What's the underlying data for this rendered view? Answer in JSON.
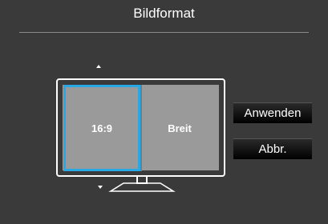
{
  "osd": {
    "title": "Bildformat"
  },
  "options": [
    {
      "label": "16:9",
      "selected": true
    },
    {
      "label": "Breit",
      "selected": false
    }
  ],
  "buttons": {
    "apply_label": "Anwenden",
    "cancel_label": "Abbr."
  },
  "colors": {
    "background": "#3a3a3a",
    "selection": "#29a8e6",
    "screen": "#9a9a9a",
    "text": "#ffffff"
  },
  "icons": {
    "scroll_up": "up-arrow-icon",
    "scroll_down": "down-arrow-icon",
    "monitor": "monitor-icon"
  }
}
